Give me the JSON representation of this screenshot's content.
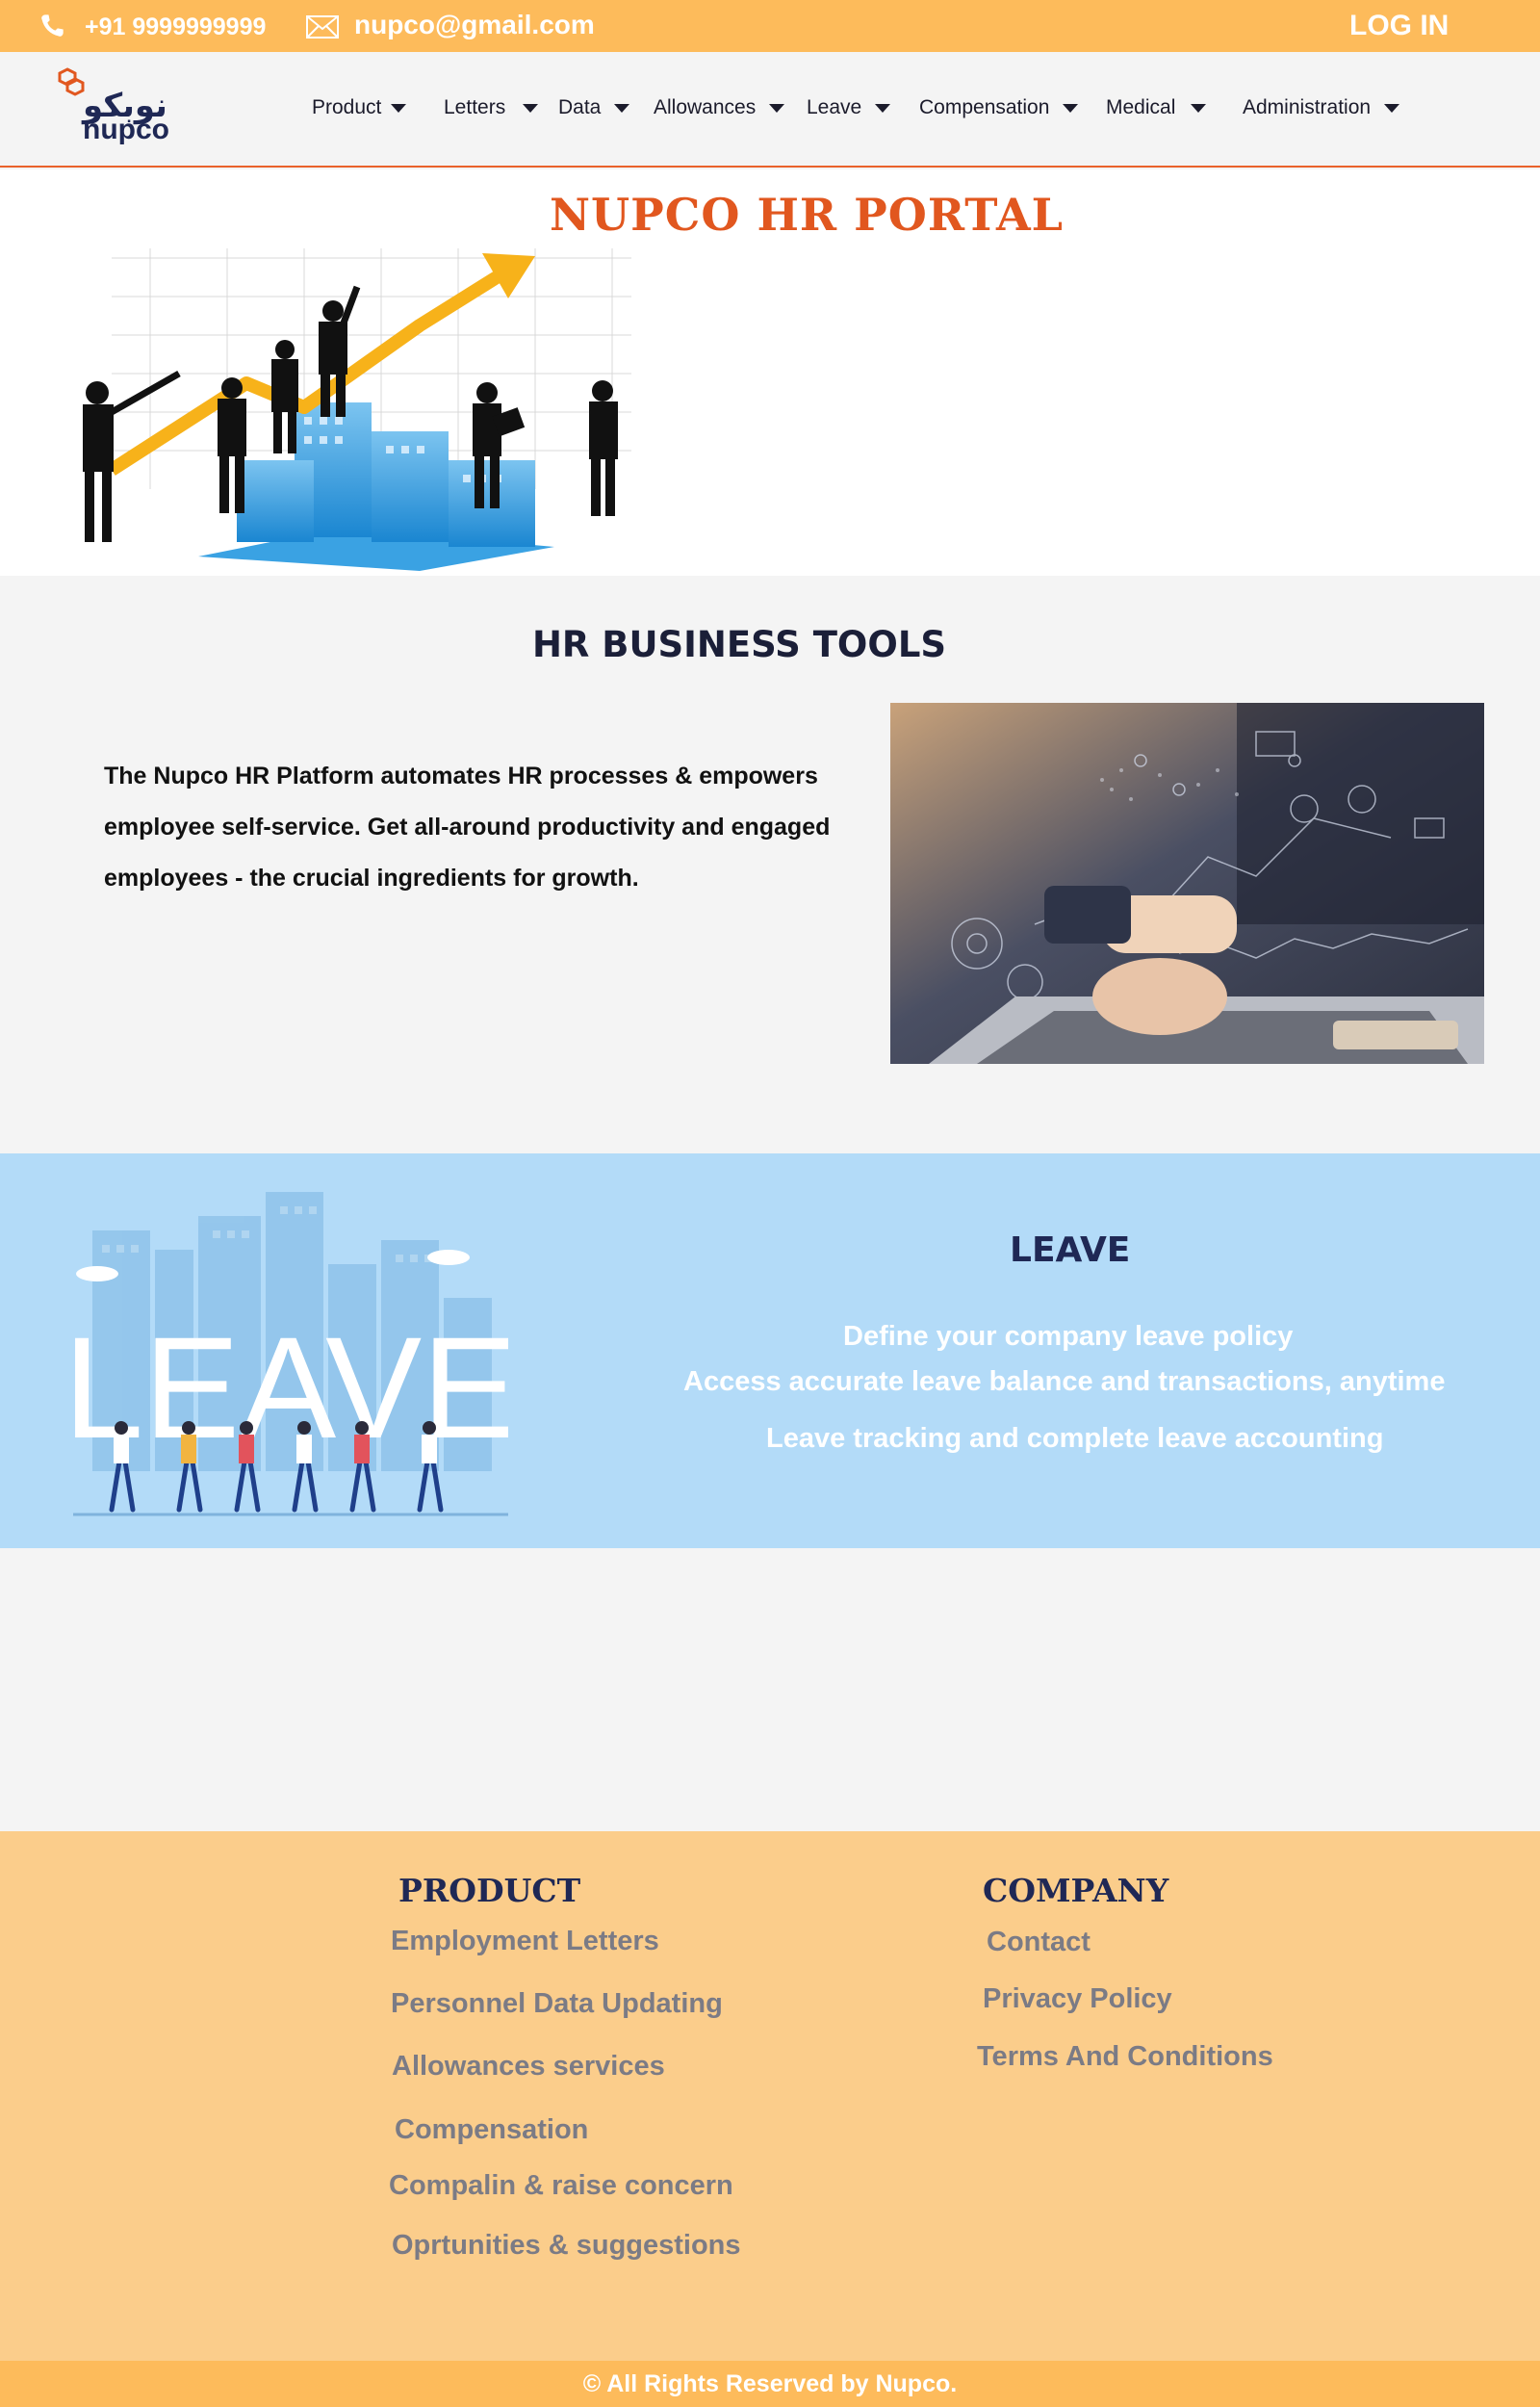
{
  "topbar": {
    "phone": "+91 9999999999",
    "email": "nupco@gmail.com",
    "login_label": "LOG IN"
  },
  "logo": {
    "arabic": "نوبكو",
    "english": "nupco"
  },
  "nav": {
    "items": [
      {
        "label": "Product"
      },
      {
        "label": "Letters"
      },
      {
        "label": "Data"
      },
      {
        "label": "Allowances"
      },
      {
        "label": "Leave"
      },
      {
        "label": "Compensation"
      },
      {
        "label": "Medical"
      },
      {
        "label": "Administration"
      }
    ]
  },
  "hero": {
    "title": "NUPCO HR PORTAL"
  },
  "tools": {
    "title": "HR BUSINESS TOOLS",
    "lines": [
      "The Nupco HR Platform automates HR processes & empowers",
      "employee  self-service. Get all-around productivity and engaged",
      "employees - the crucial ingredients for growth."
    ]
  },
  "leave": {
    "title": "LEAVE",
    "image_word": "LEAVE",
    "lines": [
      "Define your company leave policy",
      "Access accurate leave balance and transactions, anytime",
      "Leave tracking and complete leave accounting"
    ]
  },
  "footer": {
    "product_heading": "PRODUCT",
    "product_links": [
      "Employment Letters",
      "Personnel Data Updating",
      "Allowances services",
      "Compensation",
      "Compalin & raise concern",
      "Oprtunities & suggestions"
    ],
    "company_heading": "COMPANY",
    "company_links": [
      "Contact",
      "Privacy Policy",
      "Terms And Conditions"
    ],
    "copyright": "© All Rights Reserved by  Nupco."
  },
  "colors": {
    "topbar": "#fdbb5b",
    "accent": "#e1571f",
    "navy": "#1f2855",
    "leave_bg": "#b3dbf8",
    "footer_bg": "#fbcd8b"
  }
}
